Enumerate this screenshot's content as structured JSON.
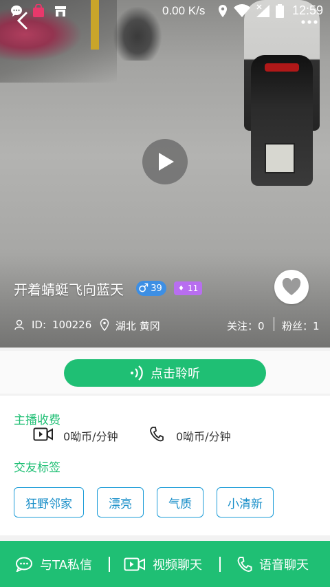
{
  "status": {
    "net_speed": "0.00 K/s",
    "time": "12:59"
  },
  "profile": {
    "name": "开着蜻蜓飞向蓝天",
    "gender_symbol": "♂",
    "age": "39",
    "level": "11",
    "id_label": "ID:",
    "id_value": "100226",
    "location": "湖北 黄冈",
    "follow_text": "关注：0",
    "fans_text": "粉丝：1"
  },
  "listen_button": "点击聆听",
  "fees": {
    "title": "主播收费",
    "video_fee": "0呦币/分钟",
    "voice_fee": "0呦币/分钟"
  },
  "tags_section": {
    "title": "交友标签",
    "tags": [
      "狂野邻家",
      "漂亮",
      "气质",
      "小清新"
    ]
  },
  "bottom": {
    "private_msg": "与TA私信",
    "video_chat": "视频聊天",
    "voice_chat": "语音聊天"
  },
  "colors": {
    "accent": "#1fbf74",
    "tag_border": "#1a9bd7",
    "age_badge": "#3d8fe4",
    "level_badge": "#b86ef0"
  }
}
